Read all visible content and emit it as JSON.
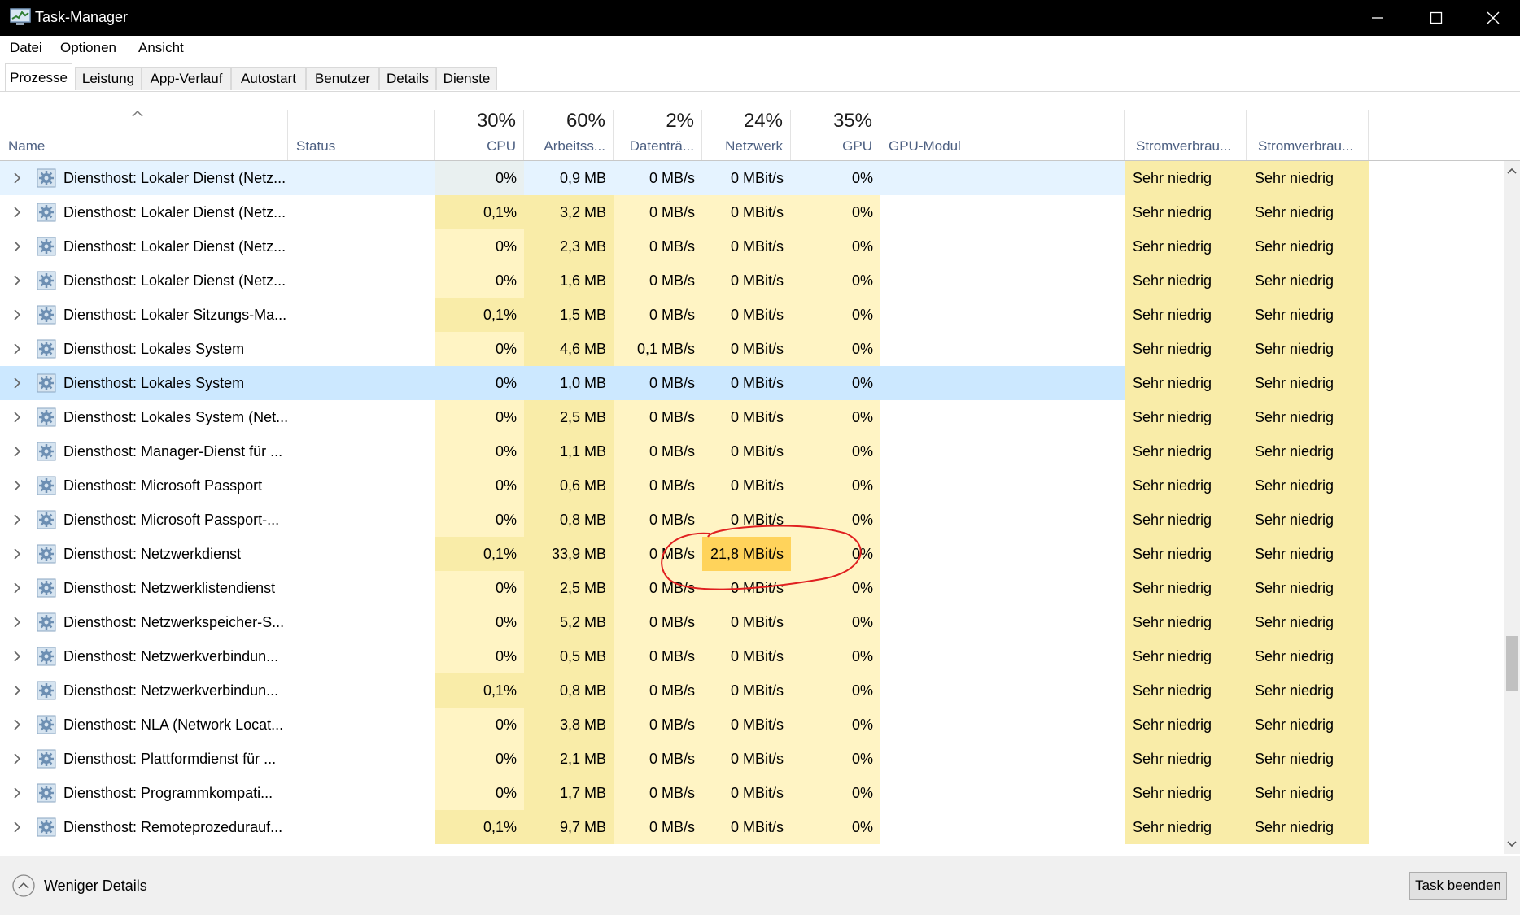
{
  "window": {
    "title": "Task-Manager"
  },
  "menu": [
    "Datei",
    "Optionen",
    "Ansicht"
  ],
  "tabs": [
    "Prozesse",
    "Leistung",
    "App-Verlauf",
    "Autostart",
    "Benutzer",
    "Details",
    "Dienste"
  ],
  "active_tab": "Prozesse",
  "columns": {
    "name": "Name",
    "status": "Status",
    "cpu": {
      "pct": "30%",
      "label": "CPU"
    },
    "memory": {
      "pct": "60%",
      "label": "Arbeitss..."
    },
    "disk": {
      "pct": "2%",
      "label": "Datenträ..."
    },
    "network": {
      "pct": "24%",
      "label": "Netzwerk"
    },
    "gpu": {
      "pct": "35%",
      "label": "GPU"
    },
    "gpu_engine": "GPU-Modul",
    "power": "Stromverbrau...",
    "power_trend": "Stromverbrau..."
  },
  "rows": [
    {
      "name": "Diensthost: Lokaler Dienst (Netz...",
      "cpu": "0%",
      "mem": "0,9 MB",
      "disk": "0 MB/s",
      "net": "0 MBit/s",
      "gpu": "0%",
      "power": "Sehr niedrig",
      "power_trend": "Sehr niedrig"
    },
    {
      "name": "Diensthost: Lokaler Dienst (Netz...",
      "cpu": "0,1%",
      "mem": "3,2 MB",
      "disk": "0 MB/s",
      "net": "0 MBit/s",
      "gpu": "0%",
      "power": "Sehr niedrig",
      "power_trend": "Sehr niedrig"
    },
    {
      "name": "Diensthost: Lokaler Dienst (Netz...",
      "cpu": "0%",
      "mem": "2,3 MB",
      "disk": "0 MB/s",
      "net": "0 MBit/s",
      "gpu": "0%",
      "power": "Sehr niedrig",
      "power_trend": "Sehr niedrig"
    },
    {
      "name": "Diensthost: Lokaler Dienst (Netz...",
      "cpu": "0%",
      "mem": "1,6 MB",
      "disk": "0 MB/s",
      "net": "0 MBit/s",
      "gpu": "0%",
      "power": "Sehr niedrig",
      "power_trend": "Sehr niedrig"
    },
    {
      "name": "Diensthost: Lokaler Sitzungs-Ma...",
      "cpu": "0,1%",
      "mem": "1,5 MB",
      "disk": "0 MB/s",
      "net": "0 MBit/s",
      "gpu": "0%",
      "power": "Sehr niedrig",
      "power_trend": "Sehr niedrig"
    },
    {
      "name": "Diensthost: Lokales System",
      "cpu": "0%",
      "mem": "4,6 MB",
      "disk": "0,1 MB/s",
      "net": "0 MBit/s",
      "gpu": "0%",
      "power": "Sehr niedrig",
      "power_trend": "Sehr niedrig"
    },
    {
      "name": "Diensthost: Lokales System",
      "cpu": "0%",
      "mem": "1,0 MB",
      "disk": "0 MB/s",
      "net": "0 MBit/s",
      "gpu": "0%",
      "power": "Sehr niedrig",
      "power_trend": "Sehr niedrig"
    },
    {
      "name": "Diensthost: Lokales System (Net...",
      "cpu": "0%",
      "mem": "2,5 MB",
      "disk": "0 MB/s",
      "net": "0 MBit/s",
      "gpu": "0%",
      "power": "Sehr niedrig",
      "power_trend": "Sehr niedrig"
    },
    {
      "name": "Diensthost: Manager-Dienst für ...",
      "cpu": "0%",
      "mem": "1,1 MB",
      "disk": "0 MB/s",
      "net": "0 MBit/s",
      "gpu": "0%",
      "power": "Sehr niedrig",
      "power_trend": "Sehr niedrig"
    },
    {
      "name": "Diensthost: Microsoft Passport",
      "cpu": "0%",
      "mem": "0,6 MB",
      "disk": "0 MB/s",
      "net": "0 MBit/s",
      "gpu": "0%",
      "power": "Sehr niedrig",
      "power_trend": "Sehr niedrig"
    },
    {
      "name": "Diensthost: Microsoft Passport-...",
      "cpu": "0%",
      "mem": "0,8 MB",
      "disk": "0 MB/s",
      "net": "0 MBit/s",
      "gpu": "0%",
      "power": "Sehr niedrig",
      "power_trend": "Sehr niedrig"
    },
    {
      "name": "Diensthost: Netzwerkdienst",
      "cpu": "0,1%",
      "mem": "33,9 MB",
      "disk": "0 MB/s",
      "net": "21,8 MBit/s",
      "gpu": "0%",
      "power": "Sehr niedrig",
      "power_trend": "Sehr niedrig"
    },
    {
      "name": "Diensthost: Netzwerklistendienst",
      "cpu": "0%",
      "mem": "2,5 MB",
      "disk": "0 MB/s",
      "net": "0 MBit/s",
      "gpu": "0%",
      "power": "Sehr niedrig",
      "power_trend": "Sehr niedrig"
    },
    {
      "name": "Diensthost: Netzwerkspeicher-S...",
      "cpu": "0%",
      "mem": "5,2 MB",
      "disk": "0 MB/s",
      "net": "0 MBit/s",
      "gpu": "0%",
      "power": "Sehr niedrig",
      "power_trend": "Sehr niedrig"
    },
    {
      "name": "Diensthost: Netzwerkverbindun...",
      "cpu": "0%",
      "mem": "0,5 MB",
      "disk": "0 MB/s",
      "net": "0 MBit/s",
      "gpu": "0%",
      "power": "Sehr niedrig",
      "power_trend": "Sehr niedrig"
    },
    {
      "name": "Diensthost: Netzwerkverbindun...",
      "cpu": "0,1%",
      "mem": "0,8 MB",
      "disk": "0 MB/s",
      "net": "0 MBit/s",
      "gpu": "0%",
      "power": "Sehr niedrig",
      "power_trend": "Sehr niedrig"
    },
    {
      "name": "Diensthost: NLA (Network Locat...",
      "cpu": "0%",
      "mem": "3,8 MB",
      "disk": "0 MB/s",
      "net": "0 MBit/s",
      "gpu": "0%",
      "power": "Sehr niedrig",
      "power_trend": "Sehr niedrig"
    },
    {
      "name": "Diensthost: Plattformdienst für ...",
      "cpu": "0%",
      "mem": "2,1 MB",
      "disk": "0 MB/s",
      "net": "0 MBit/s",
      "gpu": "0%",
      "power": "Sehr niedrig",
      "power_trend": "Sehr niedrig"
    },
    {
      "name": "Diensthost: Programmkompati...",
      "cpu": "0%",
      "mem": "1,7 MB",
      "disk": "0 MB/s",
      "net": "0 MBit/s",
      "gpu": "0%",
      "power": "Sehr niedrig",
      "power_trend": "Sehr niedrig"
    },
    {
      "name": "Diensthost: Remoteprozedurauf...",
      "cpu": "0,1%",
      "mem": "9,7 MB",
      "disk": "0 MB/s",
      "net": "0 MBit/s",
      "gpu": "0%",
      "power": "Sehr niedrig",
      "power_trend": "Sehr niedrig"
    }
  ],
  "selected_rows": [
    0,
    6
  ],
  "footer": {
    "fewer_details": "Weniger Details",
    "end_task": "Task beenden"
  },
  "colors": {
    "heat_light": "#fff4c4",
    "heat_medium": "#f9eca8",
    "heat_strong": "#ffd35b",
    "selection": "#cce8ff",
    "hover": "#e5f3ff",
    "header_label": "#4d6082",
    "annotation": "#e02020"
  }
}
